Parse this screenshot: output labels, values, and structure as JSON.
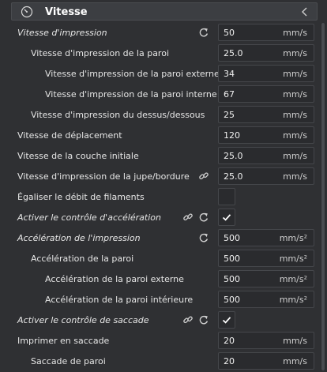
{
  "header": {
    "title": "Vitesse",
    "icon": "speedometer-icon",
    "collapse_icon": "chevron-left-icon"
  },
  "rows": [
    {
      "label": "Vitesse d'impression",
      "italic": true,
      "value": "50",
      "unit": "mm/s",
      "icons": [
        "reset-icon"
      ]
    },
    {
      "label": "Vitesse d'impression de la paroi",
      "value": "25.0",
      "unit": "mm/s"
    },
    {
      "label": "Vitesse d'impression de la paroi externe",
      "value": "34",
      "unit": "mm/s"
    },
    {
      "label": "Vitesse d'impression de la paroi interne",
      "value": "67",
      "unit": "mm/s"
    },
    {
      "label": "Vitesse d'impression du dessus/dessous",
      "value": "25",
      "unit": "mm/s"
    },
    {
      "label": "Vitesse de déplacement",
      "value": "120",
      "unit": "mm/s"
    },
    {
      "label": "Vitesse de la couche initiale",
      "value": "25.0",
      "unit": "mm/s"
    },
    {
      "label": "Vitesse d'impression de la jupe/bordure",
      "value": "25.0",
      "unit": "mm/s",
      "icons": [
        "link-icon"
      ]
    },
    {
      "label": "Égaliser le débit de filaments",
      "checkbox": true,
      "checked": false
    },
    {
      "label": "Activer le contrôle d'accélération",
      "italic": true,
      "checkbox": true,
      "checked": true,
      "icons": [
        "link-icon",
        "reset-icon"
      ]
    },
    {
      "label": "Accélération de l'impression",
      "italic": true,
      "value": "500",
      "unit": "mm/s²",
      "icons": [
        "reset-icon"
      ]
    },
    {
      "label": "Accélération de la paroi",
      "value": "500",
      "unit": "mm/s²"
    },
    {
      "label": "Accélération de la paroi externe",
      "value": "500",
      "unit": "mm/s²"
    },
    {
      "label": "Accélération de la paroi intérieure",
      "value": "500",
      "unit": "mm/s²"
    },
    {
      "label": "Activer le contrôle de saccade",
      "italic": true,
      "checkbox": true,
      "checked": true,
      "icons": [
        "link-icon",
        "reset-icon"
      ]
    },
    {
      "label": "Imprimer en saccade",
      "value": "20",
      "unit": "mm/s"
    },
    {
      "label": "Saccade de paroi",
      "value": "20",
      "unit": "mm/s"
    }
  ]
}
